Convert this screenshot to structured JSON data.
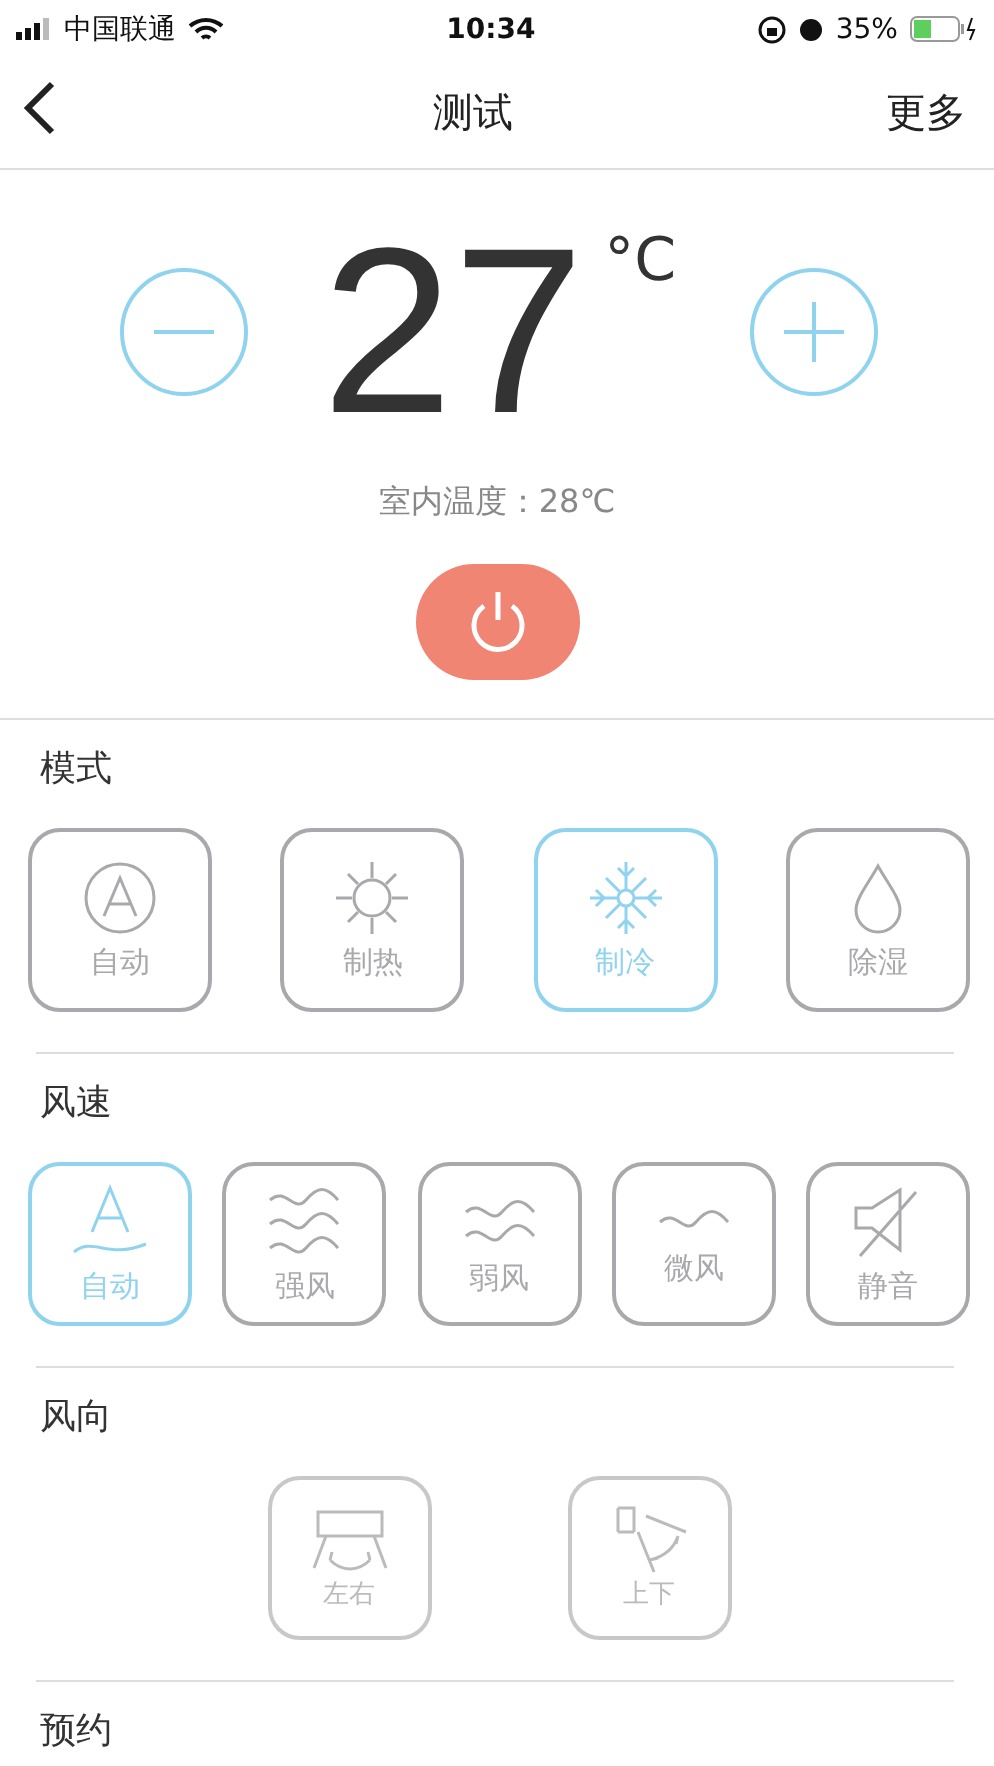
{
  "status_bar": {
    "carrier": "中国联通",
    "time": "10:34",
    "battery": "35%"
  },
  "nav": {
    "title": "测试",
    "more": "更多"
  },
  "temperature": {
    "value": "27",
    "unit": "°C",
    "indoor": "室内温度：28℃",
    "power_on": true
  },
  "mode": {
    "label": "模式",
    "options": [
      {
        "kind": "auto",
        "label": "自动",
        "selected": false
      },
      {
        "kind": "heat",
        "label": "制热",
        "selected": false
      },
      {
        "kind": "cool",
        "label": "制冷",
        "selected": true
      },
      {
        "kind": "dry",
        "label": "除湿",
        "selected": false
      }
    ]
  },
  "fan_speed": {
    "label": "风速",
    "options": [
      {
        "kind": "auto",
        "label": "自动",
        "selected": true
      },
      {
        "kind": "strong",
        "label": "强风",
        "selected": false
      },
      {
        "kind": "weak",
        "label": "弱风",
        "selected": false
      },
      {
        "kind": "breeze",
        "label": "微风",
        "selected": false
      },
      {
        "kind": "mute",
        "label": "静音",
        "selected": false
      }
    ]
  },
  "wind_direction": {
    "label": "风向",
    "options": [
      {
        "kind": "horizontal",
        "label": "左右",
        "disabled": true
      },
      {
        "kind": "vertical",
        "label": "上下",
        "disabled": true
      }
    ]
  },
  "schedule": {
    "label": "预约"
  }
}
